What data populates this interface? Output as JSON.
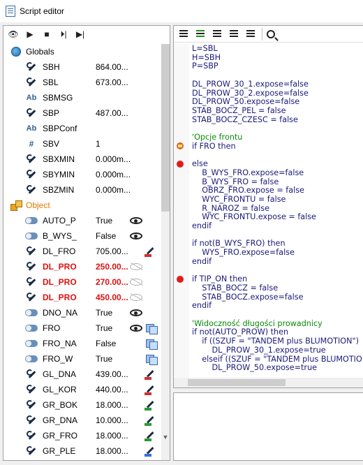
{
  "window": {
    "title": "Script editor"
  },
  "left_toolbar": {
    "buttons": [
      "eye-icon",
      "play-icon",
      "stop-icon",
      "step-into-icon",
      "step-over-icon"
    ]
  },
  "tree": {
    "groups": [
      {
        "label": "Globals",
        "icon": "globe-icon"
      },
      {
        "label": "Object",
        "icon": "cubes-icon"
      }
    ],
    "globals": [
      {
        "icon": "wrench",
        "name": "SBH",
        "value": "864.00..."
      },
      {
        "icon": "wrench",
        "name": "SBL",
        "value": "673.00..."
      },
      {
        "icon": "ab",
        "name": "SBMSG",
        "value": ""
      },
      {
        "icon": "wrench",
        "name": "SBP",
        "value": "487.00..."
      },
      {
        "icon": "ab",
        "name": "SBPConf",
        "value": ""
      },
      {
        "icon": "hash",
        "name": "SBV",
        "value": "1"
      },
      {
        "icon": "wrench",
        "name": "SBXMIN",
        "value": "0.000m..."
      },
      {
        "icon": "wrench",
        "name": "SBYMIN",
        "value": "0.000m..."
      },
      {
        "icon": "wrench",
        "name": "SBZMIN",
        "value": "0.000m..."
      }
    ],
    "object": [
      {
        "icon": "toggle",
        "name": "AUTO_P",
        "value": "True",
        "vis": "eye",
        "act": "",
        "red": false
      },
      {
        "icon": "toggle",
        "name": "B_WYS_",
        "value": "False",
        "vis": "eye",
        "act": "",
        "red": false
      },
      {
        "icon": "wrench",
        "name": "DL_FRO",
        "value": "705.00...",
        "vis": "",
        "act": "red",
        "red": false
      },
      {
        "icon": "wrench",
        "name": "DL_PRO",
        "value": "250.00...",
        "vis": "eye-off",
        "act": "",
        "red": true
      },
      {
        "icon": "wrench",
        "name": "DL_PRO",
        "value": "270.00...",
        "vis": "eye-off",
        "act": "",
        "red": true
      },
      {
        "icon": "wrench",
        "name": "DL_PRO",
        "value": "450.00...",
        "vis": "eye-off",
        "act": "",
        "red": true
      },
      {
        "icon": "toggle",
        "name": "DNO_NA",
        "value": "True",
        "vis": "eye",
        "act": "",
        "red": false
      },
      {
        "icon": "toggle",
        "name": "FRO",
        "value": "True",
        "vis": "eye",
        "act": "stack",
        "red": false
      },
      {
        "icon": "toggle",
        "name": "FRO_NA",
        "value": "False",
        "vis": "",
        "act": "stack",
        "red": false
      },
      {
        "icon": "toggle",
        "name": "FRO_W",
        "value": "True",
        "vis": "",
        "act": "stack",
        "red": false
      },
      {
        "icon": "wrench",
        "name": "GL_DNA",
        "value": "439.00...",
        "vis": "",
        "act": "red",
        "red": false
      },
      {
        "icon": "wrench",
        "name": "GL_KOR",
        "value": "440.00...",
        "vis": "",
        "act": "red",
        "red": false
      },
      {
        "icon": "wrench",
        "name": "GR_BOK",
        "value": "18.000...",
        "vis": "",
        "act": "green",
        "red": false
      },
      {
        "icon": "wrench",
        "name": "GR_DNA",
        "value": "10.000...",
        "vis": "",
        "act": "green",
        "red": false
      },
      {
        "icon": "wrench",
        "name": "GR_FRO",
        "value": "18.000...",
        "vis": "",
        "act": "green",
        "red": false
      },
      {
        "icon": "wrench",
        "name": "GR_PLE",
        "value": "18.000...",
        "vis": "",
        "act": "blue",
        "red": false
      }
    ]
  },
  "editor_toolbar": {
    "buttons": [
      "indent-icon",
      "outdent-icon",
      "comment-icon",
      "uncomment-icon",
      "format-icon",
      "search-icon"
    ]
  },
  "code_lines": [
    {
      "text": "L=SBL",
      "cls": "",
      "bp": ""
    },
    {
      "text": "H=SBH",
      "cls": "",
      "bp": ""
    },
    {
      "text": "P=SBP",
      "cls": "",
      "bp": ""
    },
    {
      "text": "",
      "cls": "",
      "bp": ""
    },
    {
      "text": "DL_PROW_30_1.expose=false",
      "cls": "",
      "bp": ""
    },
    {
      "text": "DL_PROW_30_2.expose=false",
      "cls": "",
      "bp": ""
    },
    {
      "text": "DL_PROW_50.expose=false",
      "cls": "",
      "bp": ""
    },
    {
      "text": "STAB_BOCZ_PEL = false",
      "cls": "",
      "bp": ""
    },
    {
      "text": "STAB_BOCZ_CZESC = false",
      "cls": "",
      "bp": ""
    },
    {
      "text": "",
      "cls": "",
      "bp": ""
    },
    {
      "text": "'Opcje frontu",
      "cls": "cm",
      "bp": ""
    },
    {
      "text": "if FRO then",
      "cls": "",
      "bp": "current"
    },
    {
      "text": "",
      "cls": "",
      "bp": ""
    },
    {
      "text": "else",
      "cls": "",
      "bp": "breakpoint"
    },
    {
      "text": "    B_WYS_FRO.expose=false",
      "cls": "",
      "bp": ""
    },
    {
      "text": "    B_WYS_FRO = false",
      "cls": "",
      "bp": ""
    },
    {
      "text": "    OBRZ_FRO.expose = false",
      "cls": "",
      "bp": ""
    },
    {
      "text": "    WYC_FRONTU = false",
      "cls": "",
      "bp": ""
    },
    {
      "text": "    R_NAROZ = false",
      "cls": "",
      "bp": ""
    },
    {
      "text": "    WYC_FRONTU.expose = false",
      "cls": "",
      "bp": ""
    },
    {
      "text": "endif",
      "cls": "",
      "bp": ""
    },
    {
      "text": "",
      "cls": "",
      "bp": ""
    },
    {
      "text": "if not(B_WYS_FRO) then",
      "cls": "",
      "bp": ""
    },
    {
      "text": "    WYS_FRO.expose=false",
      "cls": "",
      "bp": ""
    },
    {
      "text": "endif",
      "cls": "",
      "bp": ""
    },
    {
      "text": "",
      "cls": "",
      "bp": ""
    },
    {
      "text": "if TIP_ON then",
      "cls": "",
      "bp": "breakpoint"
    },
    {
      "text": "    STAB_BOCZ = false",
      "cls": "",
      "bp": ""
    },
    {
      "text": "    STAB_BOCZ.expose=false",
      "cls": "",
      "bp": ""
    },
    {
      "text": "endif",
      "cls": "",
      "bp": ""
    },
    {
      "text": "",
      "cls": "",
      "bp": ""
    },
    {
      "text": "'Widoczność długości prowadnicy",
      "cls": "cm",
      "bp": ""
    },
    {
      "text": "if not(AUTO_PROW) then",
      "cls": "",
      "bp": ""
    },
    {
      "text": "    if ((SZUF = \"TANDEM plus BLUMOTION\")",
      "cls": "",
      "bp": ""
    },
    {
      "text": "        DL_PROW_30_1.expose=true",
      "cls": "",
      "bp": ""
    },
    {
      "text": "    elseif ((SZUF = \"TANDEM plus BLUMOTIO",
      "cls": "",
      "bp": ""
    },
    {
      "text": "        DL_PROW_50.expose=true",
      "cls": "",
      "bp": ""
    }
  ]
}
